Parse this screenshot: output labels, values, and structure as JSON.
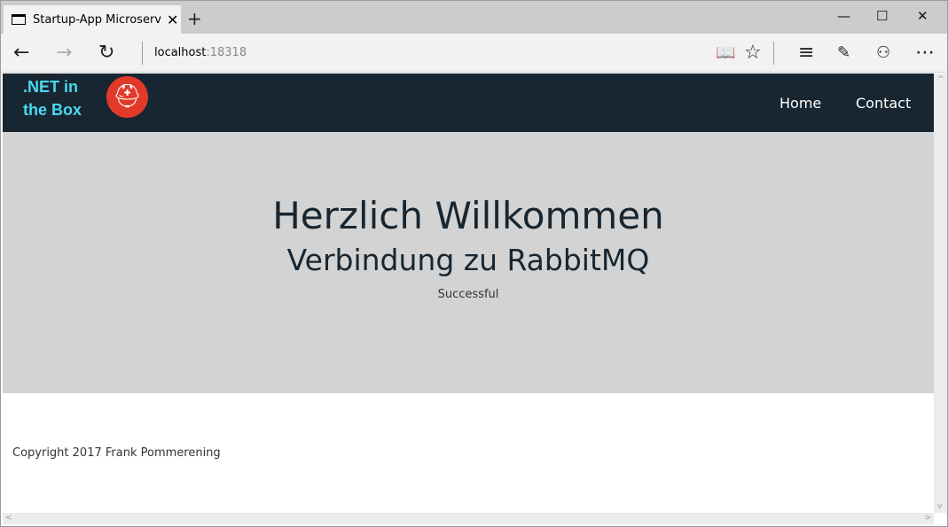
{
  "browser": {
    "tab_title": "Startup-App Microservices",
    "url_host": "localhost",
    "url_port": ":18318"
  },
  "site": {
    "brand": ".NET in the Box",
    "nav": [
      "Home",
      "Contact"
    ]
  },
  "hero": {
    "title": "Herzlich Willkommen",
    "subtitle": "Verbindung zu RabbitMQ",
    "status": "Successful"
  },
  "footer": {
    "copyright": "Copyright 2017 Frank Pommerening"
  },
  "colors": {
    "navbar": "#172631",
    "brand": "#4ad9ef",
    "hero_bg": "#d3d3d3",
    "logo": "#e23a2a"
  }
}
